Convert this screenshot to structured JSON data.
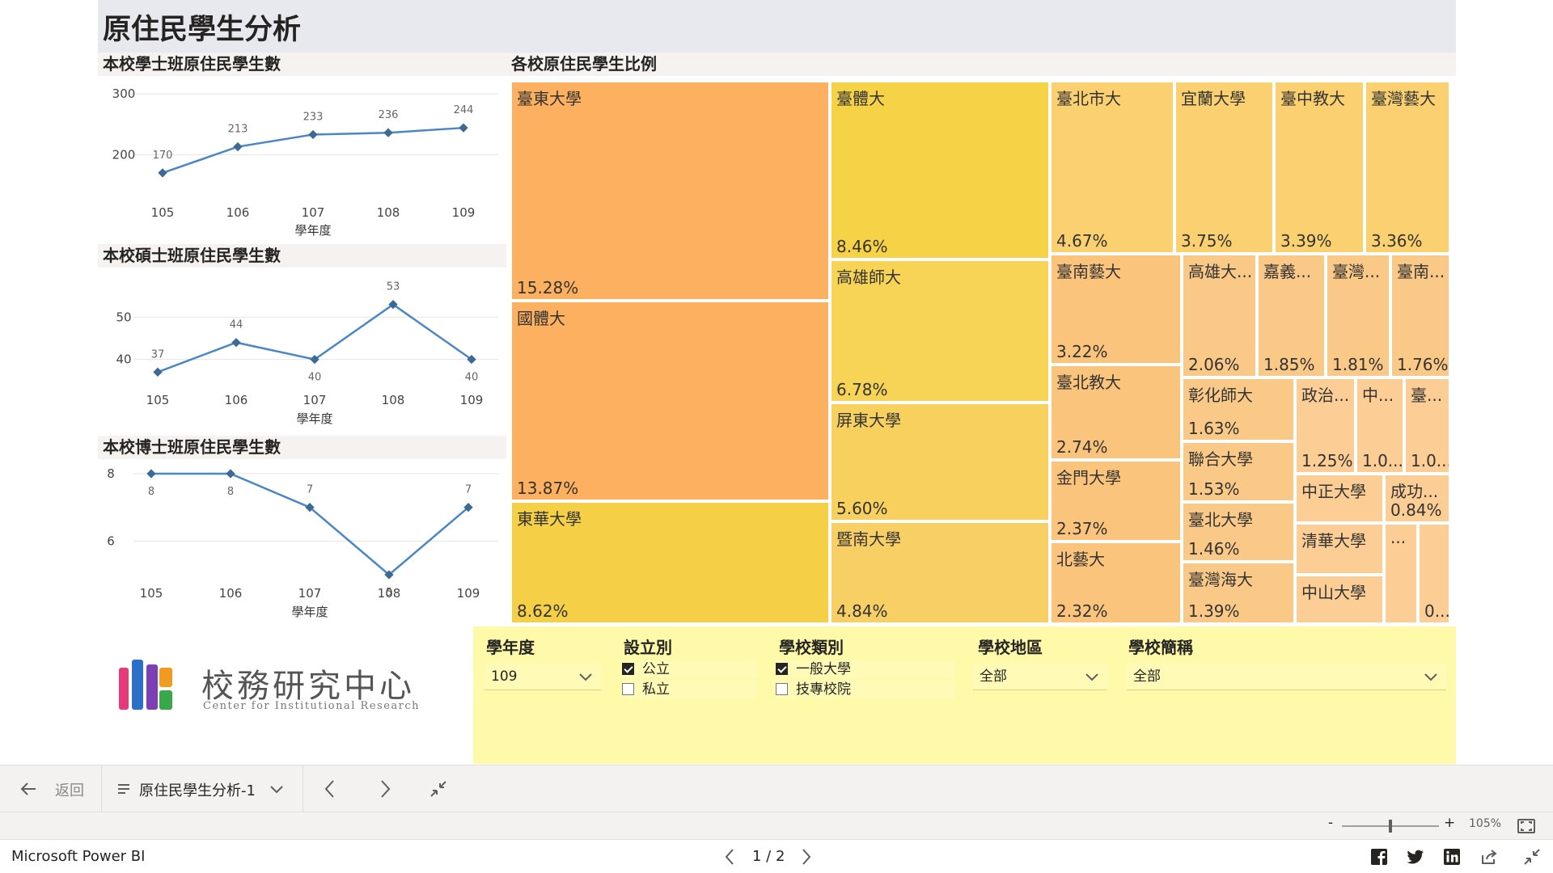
{
  "page": {
    "title": "原住民學生分析"
  },
  "charts_meta": {
    "bachelor_header": "本校學士班原住民學生數",
    "master_header": "本校碩士班原住民學生數",
    "doctoral_header": "本校博士班原住民學生數",
    "treemap_header": "各校原住民學生比例"
  },
  "chart_data": [
    {
      "type": "line",
      "title": "本校學士班原住民學生數",
      "x": [
        "105",
        "106",
        "107",
        "108",
        "109"
      ],
      "values": [
        170,
        213,
        233,
        236,
        244
      ],
      "xlabel": "學年度",
      "ylim": [
        150,
        300
      ],
      "yticks": [
        "200",
        "300"
      ],
      "color": "#4a86c8"
    },
    {
      "type": "line",
      "title": "本校碩士班原住民學生數",
      "x": [
        "105",
        "106",
        "107",
        "108",
        "109"
      ],
      "values": [
        37,
        44,
        40,
        53,
        40
      ],
      "xlabel": "學年度",
      "ylim": [
        34,
        56
      ],
      "yticks": [
        "40",
        "50"
      ],
      "color": "#4a86c8"
    },
    {
      "type": "line",
      "title": "本校博士班原住民學生數",
      "x": [
        "105",
        "106",
        "107",
        "108",
        "109"
      ],
      "values": [
        8,
        8,
        7,
        5,
        7
      ],
      "xlabel": "學年度",
      "ylim": [
        5,
        8
      ],
      "yticks": [
        "6",
        "8"
      ],
      "color": "#4a86c8"
    },
    {
      "type": "treemap",
      "title": "各校原住民學生比例",
      "items": [
        {
          "name": "臺東大學",
          "pct": "15.28%",
          "color": "#fdb05f"
        },
        {
          "name": "國體大",
          "pct": "13.87%",
          "color": "#fdb05f"
        },
        {
          "name": "東華大學",
          "pct": "8.62%",
          "color": "#f5cf45"
        },
        {
          "name": "臺體大",
          "pct": "8.46%",
          "color": "#f5d246"
        },
        {
          "name": "高雄師大",
          "pct": "6.78%",
          "color": "#f7d456"
        },
        {
          "name": "屏東大學",
          "pct": "5.60%",
          "color": "#f7d05e"
        },
        {
          "name": "暨南大學",
          "pct": "4.84%",
          "color": "#f8cf64"
        },
        {
          "name": "臺北市大",
          "pct": "4.67%",
          "color": "#fbd070"
        },
        {
          "name": "宜蘭大學",
          "pct": "3.75%",
          "color": "#fbd070"
        },
        {
          "name": "臺中教大",
          "pct": "3.39%",
          "color": "#fbd070"
        },
        {
          "name": "臺灣藝大",
          "pct": "3.36%",
          "color": "#fbd070"
        },
        {
          "name": "臺南藝大",
          "pct": "3.22%",
          "color": "#fbc47c"
        },
        {
          "name": "臺北教大",
          "pct": "2.74%",
          "color": "#fbc47c"
        },
        {
          "name": "金門大學",
          "pct": "2.37%",
          "color": "#fbc47c"
        },
        {
          "name": "北藝大",
          "pct": "2.32%",
          "color": "#fbc47c"
        },
        {
          "name": "高雄大...",
          "pct": "2.06%",
          "color": "#fbc987"
        },
        {
          "name": "嘉義...",
          "pct": "1.85%",
          "color": "#fbc987"
        },
        {
          "name": "臺灣...",
          "pct": "1.81%",
          "color": "#fbc987"
        },
        {
          "name": "臺南...",
          "pct": "1.76%",
          "color": "#fbc987"
        },
        {
          "name": "彰化師大",
          "pct": "1.63%",
          "color": "#fbc987"
        },
        {
          "name": "聯合大學",
          "pct": "1.53%",
          "color": "#fbc987"
        },
        {
          "name": "臺北大學",
          "pct": "1.46%",
          "color": "#fbc987"
        },
        {
          "name": "臺灣海大",
          "pct": "1.39%",
          "color": "#fbc987"
        },
        {
          "name": "政治...",
          "pct": "1.25%",
          "color": "#fcce96"
        },
        {
          "name": "中...",
          "pct": "1.0...",
          "color": "#fcce96"
        },
        {
          "name": "臺...",
          "pct": "1.0...",
          "color": "#fcce96"
        },
        {
          "name": "中正大學",
          "pct": "",
          "color": "#fcce96"
        },
        {
          "name": "成功...",
          "pct": "0.84%",
          "color": "#fcce96"
        },
        {
          "name": "清華大學",
          "pct": "",
          "color": "#fcce96"
        },
        {
          "name": "...",
          "pct": "",
          "color": "#fcce96"
        },
        {
          "name": "中山大學",
          "pct": "",
          "color": "#fcce96"
        },
        {
          "name": "",
          "pct": "0....",
          "color": "#fcce96"
        },
        {
          "name": "",
          "pct": "",
          "color": "#fcce96"
        }
      ]
    }
  ],
  "logo": {
    "title": "校務研究中心",
    "subtitle": "Center for Institutional Research"
  },
  "slicers": {
    "year": {
      "title": "學年度",
      "value": "109"
    },
    "type": {
      "title": "設立別",
      "options": [
        {
          "label": "公立",
          "checked": true
        },
        {
          "label": "私立",
          "checked": false
        }
      ]
    },
    "category": {
      "title": "學校類別",
      "options": [
        {
          "label": "一般大學",
          "checked": true
        },
        {
          "label": "技專校院",
          "checked": false
        }
      ]
    },
    "region": {
      "title": "學校地區",
      "value": "全部"
    },
    "school": {
      "title": "學校簡稱",
      "value": "全部"
    }
  },
  "nav": {
    "back_label": "返回",
    "page_selector": "原住民學生分析-1"
  },
  "zoom": {
    "minus": "-",
    "plus": "+",
    "level": "105%"
  },
  "footer": {
    "brand": "Microsoft Power BI",
    "pager": "1 / 2"
  }
}
